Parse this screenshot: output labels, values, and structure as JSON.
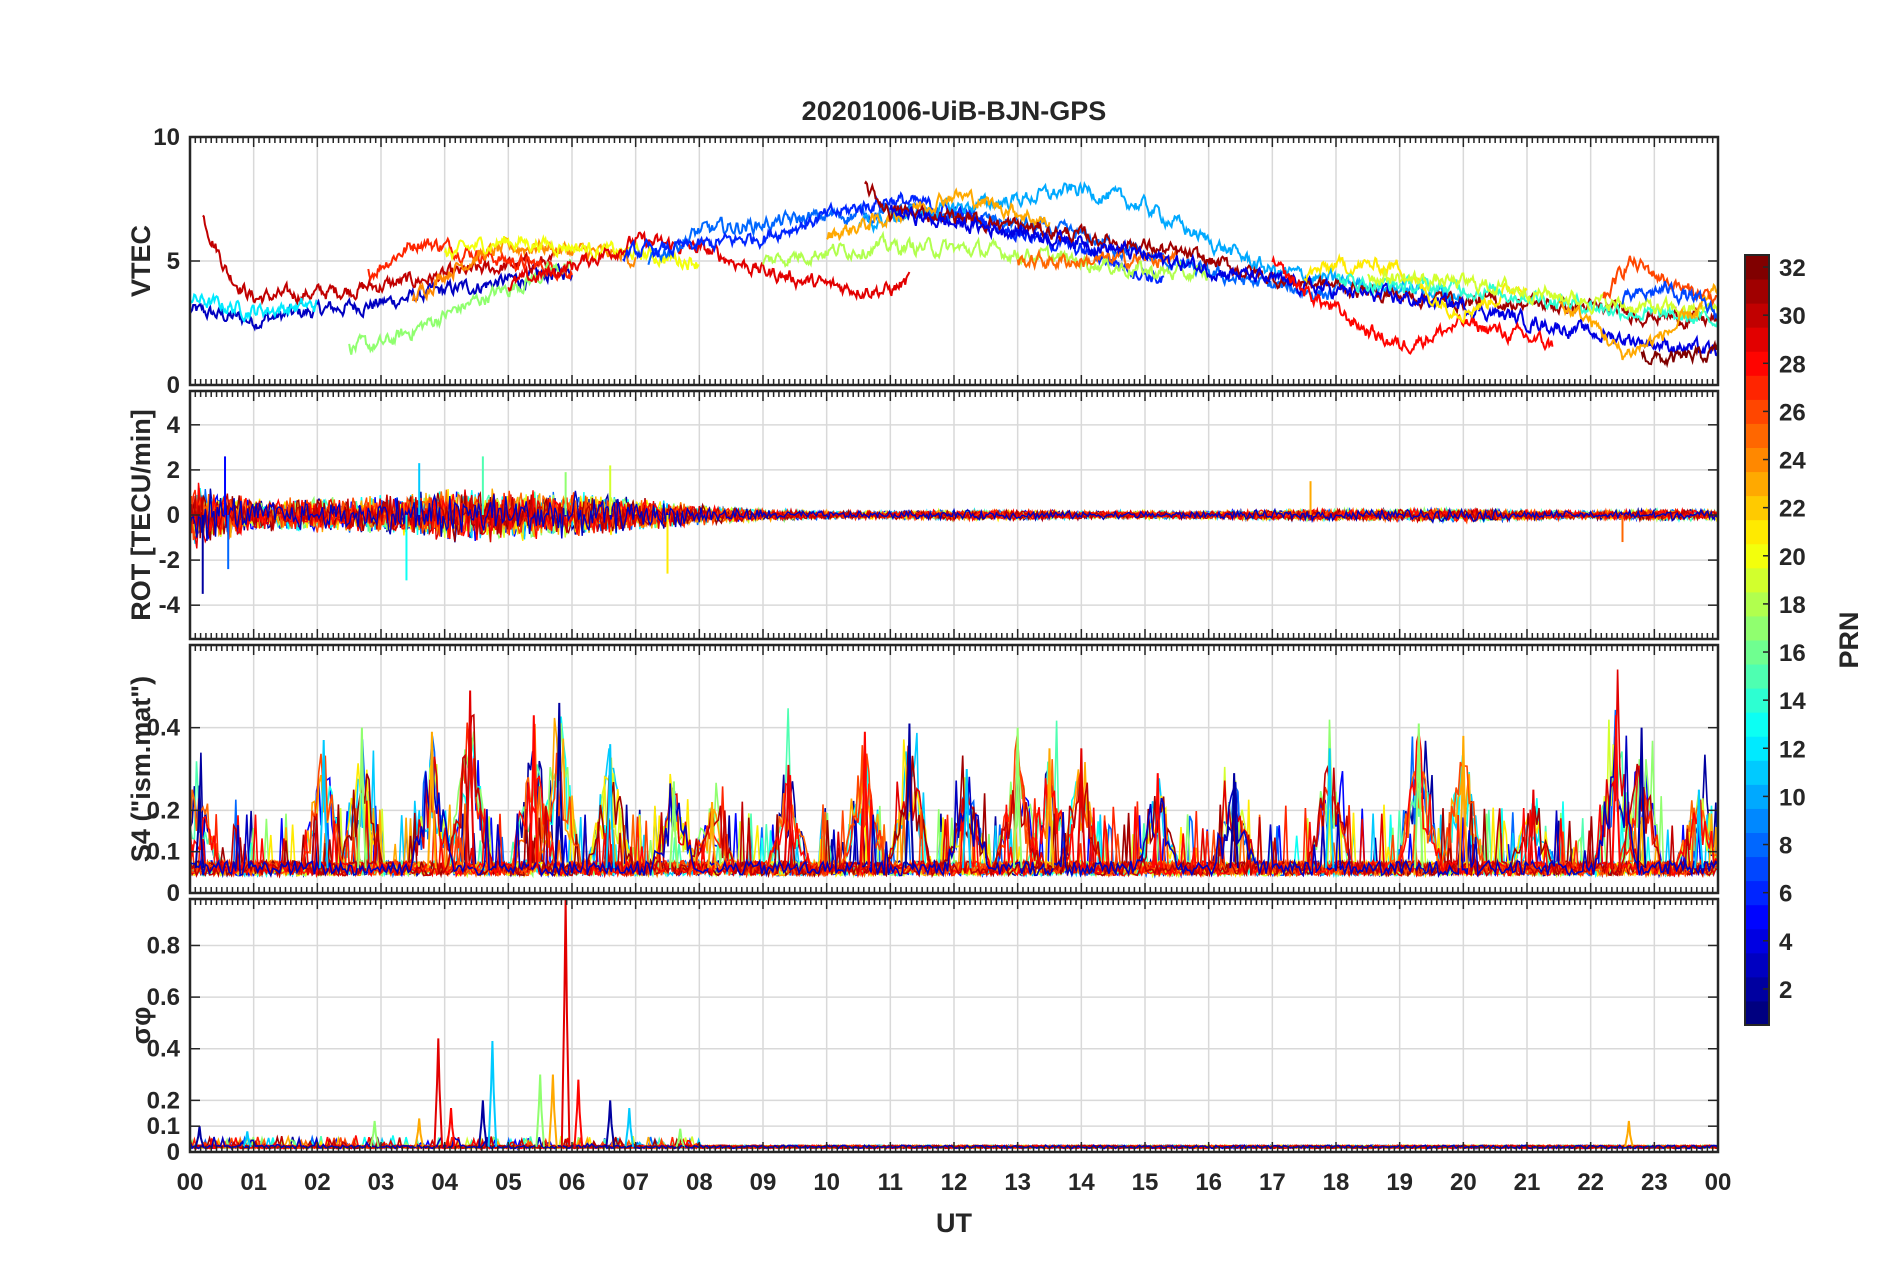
{
  "title": "20201006-UiB-BJN-GPS",
  "xlabel": "UT",
  "x_ticks": [
    "00",
    "01",
    "02",
    "03",
    "04",
    "05",
    "06",
    "07",
    "08",
    "09",
    "10",
    "11",
    "12",
    "13",
    "14",
    "15",
    "16",
    "17",
    "18",
    "19",
    "20",
    "21",
    "22",
    "23",
    "00"
  ],
  "colorbar": {
    "label": "PRN",
    "ticks": [
      "2",
      "4",
      "6",
      "8",
      "10",
      "12",
      "14",
      "16",
      "18",
      "20",
      "22",
      "24",
      "26",
      "28",
      "30",
      "32"
    ],
    "range": [
      1,
      32
    ],
    "colormap": "jet"
  },
  "chart_data": [
    {
      "type": "line",
      "ylabel": "VTEC",
      "ylim": [
        0,
        10
      ],
      "y_ticks": [
        "0",
        "5",
        "10"
      ],
      "grid": true,
      "x_unit": "hours UT",
      "x_range": [
        0,
        24
      ],
      "series_style": "noisy",
      "series": [
        {
          "prn": 3,
          "x": [
            0.0,
            0.5,
            1.0,
            1.5,
            2.0,
            3.0,
            4.0,
            5.0,
            6.0
          ],
          "y": [
            3.0,
            2.8,
            2.6,
            2.8,
            3.0,
            3.3,
            3.8,
            4.2,
            4.6
          ]
        },
        {
          "prn": 30,
          "x": [
            0.2,
            0.6,
            1.0,
            1.5,
            2.0,
            3.0,
            4.0,
            5.0,
            5.8
          ],
          "y": [
            6.8,
            4.5,
            3.5,
            3.6,
            3.7,
            4.0,
            4.4,
            4.8,
            5.0
          ]
        },
        {
          "prn": 27,
          "x": [
            2.8,
            3.2,
            3.6,
            4.0,
            4.5,
            5.0,
            5.5,
            6.0
          ],
          "y": [
            4.5,
            5.2,
            5.8,
            5.6,
            5.3,
            5.0,
            4.8,
            4.6
          ]
        },
        {
          "prn": 17,
          "x": [
            2.5,
            3.0,
            3.5,
            4.0,
            4.5,
            5.0,
            5.5,
            6.0
          ],
          "y": [
            1.5,
            1.6,
            2.2,
            2.8,
            3.4,
            3.9,
            4.4,
            4.8
          ]
        },
        {
          "prn": 12,
          "x": [
            0.0,
            0.5,
            1.0,
            1.5,
            2.0
          ],
          "y": [
            3.5,
            3.2,
            3.0,
            3.1,
            3.2
          ]
        },
        {
          "prn": 24,
          "x": [
            3.5,
            4.0,
            4.5,
            5.0,
            5.5,
            6.0,
            6.5,
            7.0
          ],
          "y": [
            3.5,
            4.5,
            5.2,
            5.5,
            5.6,
            5.4,
            5.3,
            5.1
          ]
        },
        {
          "prn": 20,
          "x": [
            4.0,
            4.5,
            5.0,
            5.5,
            6.0,
            6.5,
            7.0,
            7.5,
            8.0
          ],
          "y": [
            5.2,
            5.6,
            5.8,
            5.7,
            5.6,
            5.4,
            5.3,
            5.1,
            5.0
          ]
        },
        {
          "prn": 29,
          "x": [
            5.0,
            6.0,
            7.0,
            8.0,
            9.0,
            10.0,
            11.0,
            11.3
          ],
          "y": [
            4.0,
            4.8,
            5.8,
            5.5,
            4.6,
            4.0,
            3.8,
            4.2
          ]
        },
        {
          "prn": 8,
          "x": [
            7.2,
            8.0,
            9.0,
            10.0,
            11.0,
            12.0,
            13.0,
            14.0,
            15.0,
            16.0,
            17.0,
            18.0
          ],
          "y": [
            5.0,
            6.2,
            6.5,
            6.8,
            7.0,
            6.8,
            6.5,
            6.0,
            5.2,
            4.5,
            4.0,
            3.6
          ]
        },
        {
          "prn": 6,
          "x": [
            6.8,
            8.0,
            9.0,
            10.0,
            11.0,
            12.0,
            13.0,
            14.0,
            14.5,
            15.3
          ],
          "y": [
            5.3,
            5.6,
            6.0,
            6.8,
            7.5,
            7.0,
            6.2,
            5.4,
            5.0,
            4.2
          ]
        },
        {
          "prn": 10,
          "x": [
            10.5,
            11.5,
            12.5,
            13.5,
            14.0,
            15.0,
            16.0,
            17.0,
            18.0,
            19.0,
            20.0
          ],
          "y": [
            6.4,
            7.0,
            7.3,
            7.7,
            7.9,
            7.2,
            5.8,
            4.6,
            4.2,
            3.9,
            3.6
          ]
        },
        {
          "prn": 18,
          "x": [
            9.0,
            10.0,
            11.0,
            12.0,
            13.0,
            14.0,
            15.0,
            16.0
          ],
          "y": [
            5.0,
            5.4,
            5.6,
            5.5,
            5.3,
            5.0,
            4.6,
            4.4
          ]
        },
        {
          "prn": 23,
          "x": [
            10.0,
            11.0,
            12.0,
            13.0,
            13.5
          ],
          "y": [
            6.0,
            6.8,
            7.7,
            7.0,
            6.5
          ]
        },
        {
          "prn": 25,
          "x": [
            13.0,
            14.0,
            15.0,
            15.5
          ],
          "y": [
            5.0,
            5.0,
            5.1,
            5.0
          ]
        },
        {
          "prn": 31,
          "x": [
            10.6,
            11.0,
            12.0,
            13.0,
            14.0,
            15.0,
            16.0,
            17.0,
            18.0,
            19.0,
            20.0,
            21.0,
            22.0,
            23.0,
            24.0
          ],
          "y": [
            8.0,
            7.0,
            6.8,
            6.4,
            6.0,
            5.6,
            5.0,
            4.3,
            4.0,
            3.6,
            3.4,
            3.3,
            3.1,
            2.8,
            2.6
          ]
        },
        {
          "prn": 4,
          "x": [
            11.0,
            12.0,
            13.0,
            14.0,
            15.0,
            16.0,
            17.0,
            18.0,
            19.0,
            20.0,
            21.0,
            22.0,
            23.0,
            24.0
          ],
          "y": [
            7.0,
            6.5,
            6.2,
            5.8,
            5.2,
            4.7,
            4.2,
            3.8,
            3.5,
            3.2,
            2.6,
            2.1,
            1.7,
            1.3
          ]
        },
        {
          "prn": 28,
          "x": [
            17.0,
            17.5,
            18.0,
            18.5,
            19.0,
            19.5,
            20.0,
            20.5,
            21.0,
            21.4
          ],
          "y": [
            4.8,
            3.8,
            3.0,
            2.2,
            1.6,
            2.0,
            2.5,
            2.2,
            1.9,
            1.6
          ]
        },
        {
          "prn": 21,
          "x": [
            17.5,
            18.0,
            19.0,
            19.5,
            20.0,
            20.5,
            21.0
          ],
          "y": [
            4.4,
            4.8,
            4.8,
            3.5,
            3.0,
            3.5,
            4.2
          ]
        },
        {
          "prn": 14,
          "x": [
            18.0,
            19.0,
            20.0,
            21.0,
            22.0,
            23.0,
            24.0
          ],
          "y": [
            4.2,
            4.0,
            3.9,
            3.6,
            3.2,
            2.8,
            2.6
          ]
        },
        {
          "prn": 19,
          "x": [
            18.5,
            19.5,
            20.5,
            21.5,
            22.5,
            23.5,
            24.0
          ],
          "y": [
            4.4,
            4.2,
            4.0,
            3.6,
            3.2,
            3.0,
            3.1
          ]
        },
        {
          "prn": 23,
          "x": [
            21.5,
            22.0,
            22.5,
            23.0,
            23.5,
            24.0
          ],
          "y": [
            3.2,
            2.6,
            1.2,
            1.8,
            2.6,
            3.8
          ]
        },
        {
          "prn": 26,
          "x": [
            22.2,
            22.6,
            23.0,
            23.5,
            24.0
          ],
          "y": [
            3.4,
            5.0,
            4.5,
            3.8,
            3.5
          ]
        },
        {
          "prn": 7,
          "x": [
            22.5,
            22.8,
            23.2,
            23.6,
            24.0
          ],
          "y": [
            3.4,
            3.6,
            3.9,
            3.5,
            2.8
          ]
        },
        {
          "prn": 32,
          "x": [
            22.8,
            23.2,
            23.6,
            24.0
          ],
          "y": [
            1.2,
            1.0,
            1.1,
            1.3
          ]
        }
      ]
    },
    {
      "type": "line",
      "ylabel": "ROT [TECU/min]",
      "ylim": [
        -5.5,
        5.5
      ],
      "y_ticks": [
        "4",
        "2",
        "0",
        "-2",
        "-4"
      ],
      "grid": true,
      "series_style": "noise",
      "noise_envelope": {
        "x": [
          0,
          1,
          2,
          3,
          4,
          5,
          6,
          7,
          8,
          9,
          10,
          11,
          12,
          13,
          14,
          15,
          16,
          17,
          18,
          19,
          20,
          21,
          22,
          23,
          24
        ],
        "amplitude": [
          1.6,
          0.8,
          0.8,
          0.9,
          1.3,
          1.2,
          1.1,
          0.8,
          0.5,
          0.3,
          0.2,
          0.2,
          0.25,
          0.25,
          0.2,
          0.2,
          0.2,
          0.25,
          0.3,
          0.3,
          0.35,
          0.25,
          0.2,
          0.3,
          0.25
        ]
      },
      "peaks": [
        {
          "x": 0.2,
          "y": -3.5
        },
        {
          "x": 0.55,
          "y": 2.6
        },
        {
          "x": 0.6,
          "y": -2.4
        },
        {
          "x": 3.6,
          "y": 2.3
        },
        {
          "x": 3.4,
          "y": -2.9
        },
        {
          "x": 4.6,
          "y": 2.6
        },
        {
          "x": 5.9,
          "y": 1.9
        },
        {
          "x": 6.6,
          "y": 2.2
        },
        {
          "x": 7.5,
          "y": -2.6
        },
        {
          "x": 17.6,
          "y": 1.5
        },
        {
          "x": 22.5,
          "y": -1.2
        }
      ]
    },
    {
      "type": "line",
      "ylabel": "S4 (\"ism.mat\")",
      "ylim": [
        0,
        0.6
      ],
      "y_ticks": [
        "0",
        "0.1",
        "0.2",
        "0.4"
      ],
      "grid": true,
      "series_style": "bursts",
      "baseline": 0.06,
      "peaks": [
        {
          "x": 0.15,
          "y": 0.26
        },
        {
          "x": 2.1,
          "y": 0.37
        },
        {
          "x": 2.7,
          "y": 0.4
        },
        {
          "x": 3.8,
          "y": 0.39
        },
        {
          "x": 4.4,
          "y": 0.49
        },
        {
          "x": 5.4,
          "y": 0.43
        },
        {
          "x": 5.8,
          "y": 0.46
        },
        {
          "x": 6.6,
          "y": 0.36
        },
        {
          "x": 7.6,
          "y": 0.27
        },
        {
          "x": 8.2,
          "y": 0.22
        },
        {
          "x": 9.4,
          "y": 0.31
        },
        {
          "x": 10.6,
          "y": 0.39
        },
        {
          "x": 11.3,
          "y": 0.41
        },
        {
          "x": 12.2,
          "y": 0.3
        },
        {
          "x": 13.0,
          "y": 0.4
        },
        {
          "x": 13.5,
          "y": 0.35
        },
        {
          "x": 14.0,
          "y": 0.35
        },
        {
          "x": 15.2,
          "y": 0.29
        },
        {
          "x": 16.4,
          "y": 0.29
        },
        {
          "x": 17.9,
          "y": 0.35
        },
        {
          "x": 19.3,
          "y": 0.41
        },
        {
          "x": 20.0,
          "y": 0.38
        },
        {
          "x": 21.1,
          "y": 0.25
        },
        {
          "x": 22.4,
          "y": 0.43
        },
        {
          "x": 22.8,
          "y": 0.4
        },
        {
          "x": 23.7,
          "y": 0.25
        }
      ]
    },
    {
      "type": "line",
      "ylabel": "σφ",
      "ylim": [
        0,
        0.98
      ],
      "y_ticks": [
        "0",
        "0.1",
        "0.2",
        "0.4",
        "0.6",
        "0.8"
      ],
      "grid": true,
      "series_style": "spikes",
      "baseline": 0.02,
      "peaks": [
        {
          "x": 0.15,
          "y": 0.1
        },
        {
          "x": 0.9,
          "y": 0.08
        },
        {
          "x": 2.9,
          "y": 0.12
        },
        {
          "x": 3.6,
          "y": 0.13
        },
        {
          "x": 3.9,
          "y": 0.44
        },
        {
          "x": 4.1,
          "y": 0.17
        },
        {
          "x": 4.6,
          "y": 0.2
        },
        {
          "x": 4.75,
          "y": 0.43
        },
        {
          "x": 5.5,
          "y": 0.3
        },
        {
          "x": 5.7,
          "y": 0.3
        },
        {
          "x": 5.9,
          "y": 0.98
        },
        {
          "x": 6.1,
          "y": 0.28
        },
        {
          "x": 6.6,
          "y": 0.2
        },
        {
          "x": 6.9,
          "y": 0.17
        },
        {
          "x": 7.7,
          "y": 0.09
        },
        {
          "x": 22.6,
          "y": 0.12
        }
      ]
    }
  ]
}
